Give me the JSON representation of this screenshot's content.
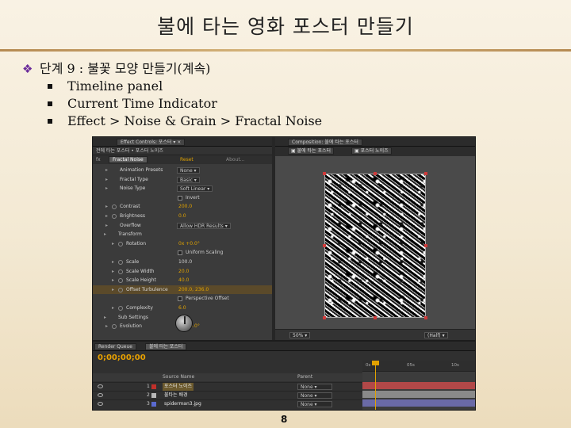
{
  "slide": {
    "title": "불에 타는 영화 포스터 만들기",
    "step": "단계 9 : 불꽃 모양 만들기(계속)",
    "bullets": [
      "Timeline panel",
      "Current Time Indicator",
      "Effect > Noise & Grain > Fractal Noise"
    ],
    "page_number": "8",
    "accent_color": "#6a2b9a",
    "bullet_mark_icon": "diamond-dots-icon"
  },
  "effect_controls": {
    "tab_label": "Effect Controls: 포스터 ▾ ×",
    "header_path": "전에 타는 포스터 • 포스터 노이즈",
    "effect_name": "Fractal Noise",
    "reset_label": "Reset",
    "about_label": "About...",
    "properties": [
      {
        "label": "Animation Presets",
        "value": "None",
        "kind": "dropdown"
      },
      {
        "label": "Fractal Type",
        "value": "Basic",
        "kind": "dropdown"
      },
      {
        "label": "Noise Type",
        "value": "Soft Linear",
        "kind": "dropdown"
      },
      {
        "label": "",
        "value": "Invert",
        "kind": "checkbox"
      },
      {
        "label": "Contrast",
        "value": "200.0",
        "kind": "number"
      },
      {
        "label": "Brightness",
        "value": "0.0",
        "kind": "number"
      },
      {
        "label": "Overflow",
        "value": "Allow HDR Results",
        "kind": "dropdown"
      },
      {
        "label": "Transform",
        "value": "",
        "kind": "group"
      },
      {
        "label": "Rotation",
        "value": "0x +0.0°",
        "kind": "number"
      },
      {
        "label": "",
        "value": "Uniform Scaling",
        "kind": "checkbox"
      },
      {
        "label": "Scale",
        "value": "100.0",
        "kind": "number"
      },
      {
        "label": "Scale Width",
        "value": "20.0",
        "kind": "number"
      },
      {
        "label": "Scale Height",
        "value": "40.0",
        "kind": "number"
      },
      {
        "label": "Offset Turbulence",
        "value": "200.0, 236.0",
        "kind": "number"
      },
      {
        "label": "",
        "value": "Perspective Offset",
        "kind": "checkbox"
      },
      {
        "label": "Complexity",
        "value": "6.0",
        "kind": "number"
      },
      {
        "label": "Sub Settings",
        "value": "",
        "kind": "group"
      },
      {
        "label": "Evolution",
        "value": "0x +0.0°",
        "kind": "number"
      }
    ]
  },
  "composition": {
    "tab_label": "Composition: 불에 타는 포스터",
    "flowchart_btn": "불에 타는 포스터",
    "layer_btn": "포스터 노이즈",
    "zoom": "50%",
    "resolution": "(Half)"
  },
  "timeline": {
    "render_queue_tab": "Render Queue",
    "comp_tab": "불에 타는 포스터",
    "timecode": "0;00;00;00",
    "source_name_header": "Source Name",
    "parent_header": "Parent",
    "layers": [
      {
        "num": "1",
        "name": "포스터 노이즈",
        "mode": "None",
        "chip_color": "#c0302a",
        "bar_color": "#b24848"
      },
      {
        "num": "2",
        "name": "불타는 배경",
        "mode": "None",
        "chip_color": "#b8b8b8",
        "bar_color": "#8a8a8a"
      },
      {
        "num": "3",
        "name": "spiderman3.jpg",
        "mode": "None",
        "chip_color": "#5a6ad0",
        "bar_color": "#6a6aa6"
      }
    ],
    "ruler_ticks": [
      "0s",
      "05s",
      "10s"
    ]
  }
}
